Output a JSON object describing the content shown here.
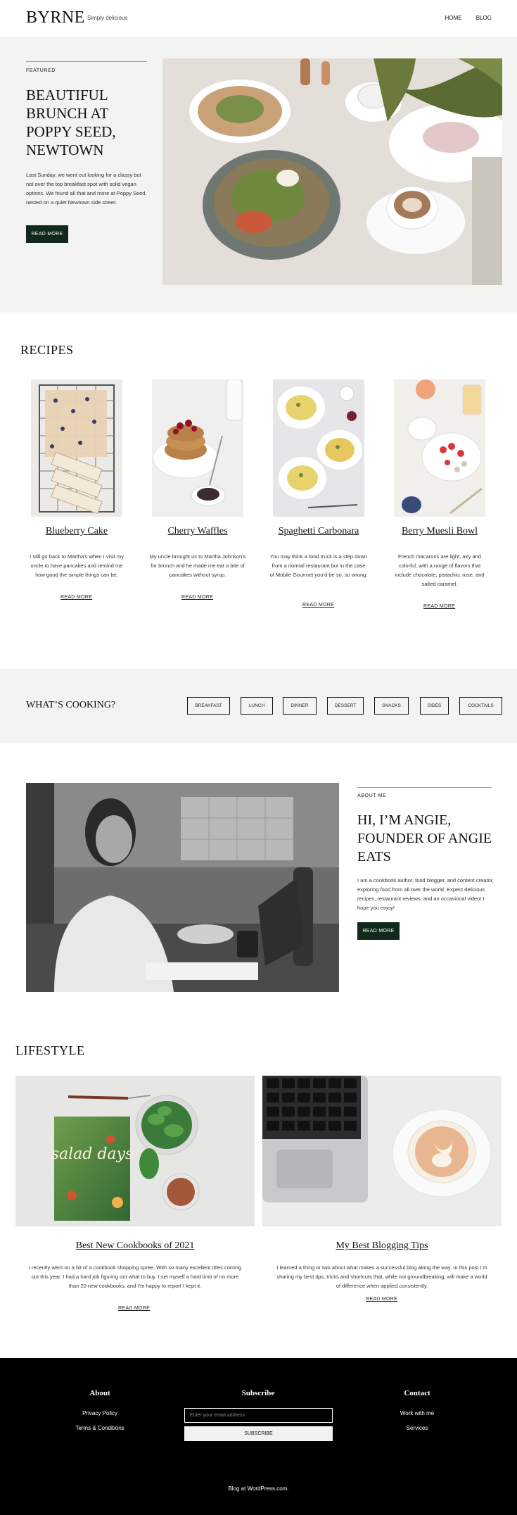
{
  "header": {
    "logo": "BYRNE",
    "tagline": "Simply delicious",
    "nav": [
      "HOME",
      "BLOG"
    ]
  },
  "hero": {
    "eyebrow": "FEATURED",
    "title": "BEAUTIFUL BRUNCH AT POPPY SEED, NEWTOWN",
    "text": "Last Sunday, we went out looking for a classy but not over the top breakfast spot with solid vegan options. We found all that and more at Poppy Seed, nested on a quiet Newtown side street.",
    "button": "READ MORE"
  },
  "recipes": {
    "title": "RECIPES",
    "items": [
      {
        "title": "Blueberry Cake",
        "text": "I still go back to Martha’s when I visit my uncle to have pancakes and remind me how good the simple things can be.",
        "link": "READ MORE"
      },
      {
        "title": "Cherry Waffles",
        "text": "My uncle brought us to Martha Johnson’s for brunch and he made me eat a bite of pancakes without syrup.",
        "link": "READ MORE"
      },
      {
        "title": "Spaghetti Carbonara",
        "text": "You may think a food truck is a step down from a normal restaurant but in the case of Mobile Gourmet you’d be so, so wrong.",
        "link": "READ MORE"
      },
      {
        "title": "Berry Muesli Bowl",
        "text": "French macarons are light, airy and colorful, with a range of flavors that include chocolate, pistachio, rose, and salted caramel.",
        "link": "READ MORE"
      }
    ]
  },
  "cooking": {
    "title": "WHAT’S COOKING?",
    "tags": [
      "BREAKFAST",
      "LUNCH",
      "DINNER",
      "DESSERT",
      "SNACKS",
      "SIDES",
      "COCKTAILS"
    ]
  },
  "about": {
    "eyebrow": "ABOUT ME",
    "title": "HI, I’M ANGIE, FOUNDER OF ANGIE EATS",
    "text": "I am a cookbook author, food blogger, and content creator, exploring food from all over the world. Expect delicious recipes, restaurant reviews, and an occasional video! I hope you enjoy!",
    "button": "READ MORE"
  },
  "lifestyle": {
    "title": "LIFESTYLE",
    "posts": [
      {
        "title": "Best New Cookbooks of 2021",
        "text": "I recently went on a bit of a cookbook shopping spree. With so many excellent titles coming out this year, I had a hard job figuring out what to buy. I set myself a hard limit of no more than 20 new cookbooks, and I’m happy to report I kept it.",
        "link": "READ MORE"
      },
      {
        "title": "My Best Blogging Tips",
        "text": "I learned a thing or two about what makes a successful blog along the way. In this post I’m sharing my best tips, tricks and shortcuts that, while not groundbreaking, will make a world of difference when applied consistently.",
        "link": "READ MORE"
      }
    ],
    "book_cover_text": "salad days"
  },
  "footer": {
    "about": {
      "heading": "About",
      "links": [
        "Privacy Policy",
        "Terms & Conditions"
      ]
    },
    "subscribe": {
      "heading": "Subscribe",
      "placeholder": "Enter your email address",
      "button": "SUBSCRIBE"
    },
    "contact": {
      "heading": "Contact",
      "links": [
        "Work with me",
        "Services"
      ]
    },
    "credit": "Blog at WordPress.com."
  },
  "colors": {
    "accent": "#10291a",
    "section_bg": "#f3f3f1",
    "footer_bg": "#000000"
  }
}
